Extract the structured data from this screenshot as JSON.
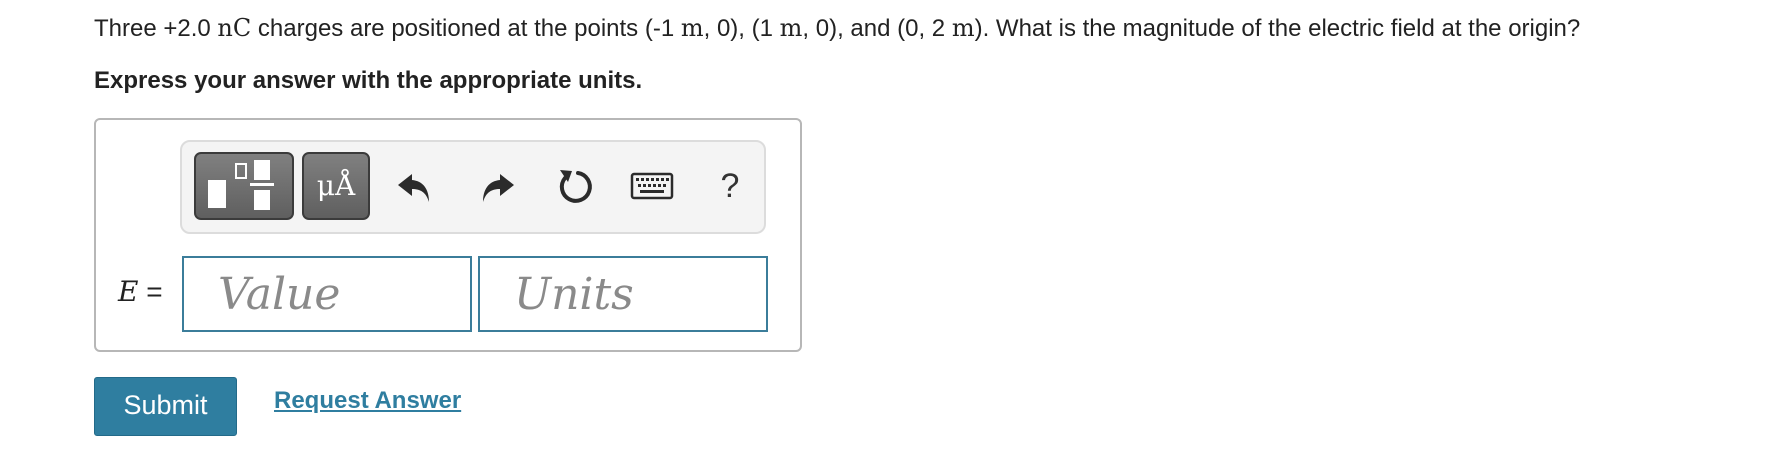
{
  "question": {
    "part1": "Three +2.0 ",
    "unit_nc": "nC",
    "part2": " charges are positioned at the points (-1 ",
    "unit_m1": "m",
    "part3": ", 0), (1 ",
    "unit_m2": "m",
    "part4": ", 0), and (0, 2 ",
    "unit_m3": "m",
    "part5": "). What is the magnitude of the electric field at the origin?"
  },
  "instruction": "Express your answer with the appropriate units.",
  "toolbar": {
    "templates_icon": "templates-icon",
    "units_label": "μÅ",
    "undo_icon": "undo-icon",
    "redo_icon": "redo-icon",
    "reset_icon": "reset-icon",
    "keyboard_icon": "keyboard-icon",
    "help_label": "?"
  },
  "answer": {
    "variable": "E",
    "equals": "=",
    "value_placeholder": "Value",
    "value": "",
    "units_placeholder": "Units",
    "units": ""
  },
  "actions": {
    "submit_label": "Submit",
    "request_label": "Request Answer"
  },
  "colors": {
    "accent": "#2f7ea0",
    "field_border": "#3b7d9a",
    "tool_button": "#6e6e6e"
  }
}
